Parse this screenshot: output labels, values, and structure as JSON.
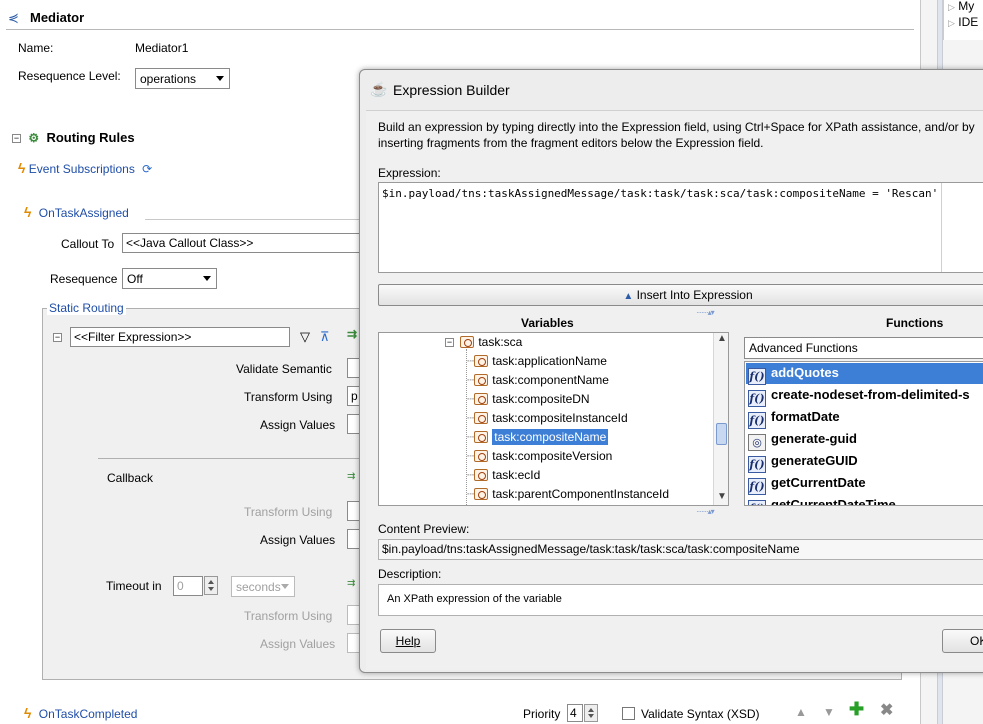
{
  "mediator": {
    "title": "Mediator",
    "name_label": "Name:",
    "name_value": "Mediator1",
    "resequence_label": "Resequence Level:",
    "resequence_value": "operations"
  },
  "right_panel": {
    "items": [
      "My",
      "IDE"
    ]
  },
  "routing": {
    "title": "Routing Rules",
    "event_subscriptions": "Event Subscriptions",
    "on_task_assigned": "OnTaskAssigned",
    "callout_label": "Callout To",
    "callout_value": "<<Java Callout Class>>",
    "resequence_label": "Resequence",
    "resequence_value": "Off",
    "static_routing": "Static Routing",
    "filter_expression": "<<Filter Expression>>",
    "validate_semantic": "Validate Semantic",
    "transform_using": "Transform Using",
    "transform_value": "p",
    "assign_values": "Assign Values",
    "callback": "Callback",
    "callback_transform": "Transform Using",
    "callback_assign": "Assign Values",
    "timeout_label": "Timeout in",
    "timeout_value": "0",
    "timeout_unit": "seconds",
    "timeout_transform": "Transform Using",
    "timeout_assign": "Assign Values",
    "on_task_completed": "OnTaskCompleted",
    "priority_label": "Priority",
    "priority_value": "4",
    "validate_syntax": "Validate Syntax (XSD)"
  },
  "dialog": {
    "title": "Expression Builder",
    "instructions": "Build an expression by typing directly into the Expression field, using Ctrl+Space for XPath assistance, and/or by inserting fragments from the fragment editors below the Expression field.",
    "expression_label": "Expression:",
    "expression_value": "$in.payload/tns:taskAssignedMessage/task:task/task:sca/task:compositeName = 'Rescan'",
    "insert_button": "Insert Into Expression",
    "variables_header": "Variables",
    "functions_header": "Functions",
    "variables_root": "task:sca",
    "variables": [
      "task:applicationName",
      "task:componentName",
      "task:compositeDN",
      "task:compositeInstanceId",
      "task:compositeName",
      "task:compositeVersion",
      "task:ecId",
      "task:parentComponentInstanceId"
    ],
    "functions_category": "Advanced Functions",
    "functions": [
      {
        "name": "addQuotes",
        "icon": "fx-icon"
      },
      {
        "name": "create-nodeset-from-delimited-s",
        "icon": "fx-icon"
      },
      {
        "name": "formatDate",
        "icon": "fx-icon"
      },
      {
        "name": "generate-guid",
        "icon": "guid-icon"
      },
      {
        "name": "generateGUID",
        "icon": "fx-icon"
      },
      {
        "name": "getCurrentDate",
        "icon": "fx-icon"
      },
      {
        "name": "getCurrentDateTime",
        "icon": "fx-icon"
      }
    ],
    "content_preview_label": "Content Preview:",
    "content_preview_value": "$in.payload/tns:taskAssignedMessage/task:task/task:sca/task:compositeName",
    "description_label": "Description:",
    "description_value": "An XPath expression of the variable",
    "help_button": "Help",
    "ok_button": "OK",
    "selection_color": "#3d7fd6"
  }
}
